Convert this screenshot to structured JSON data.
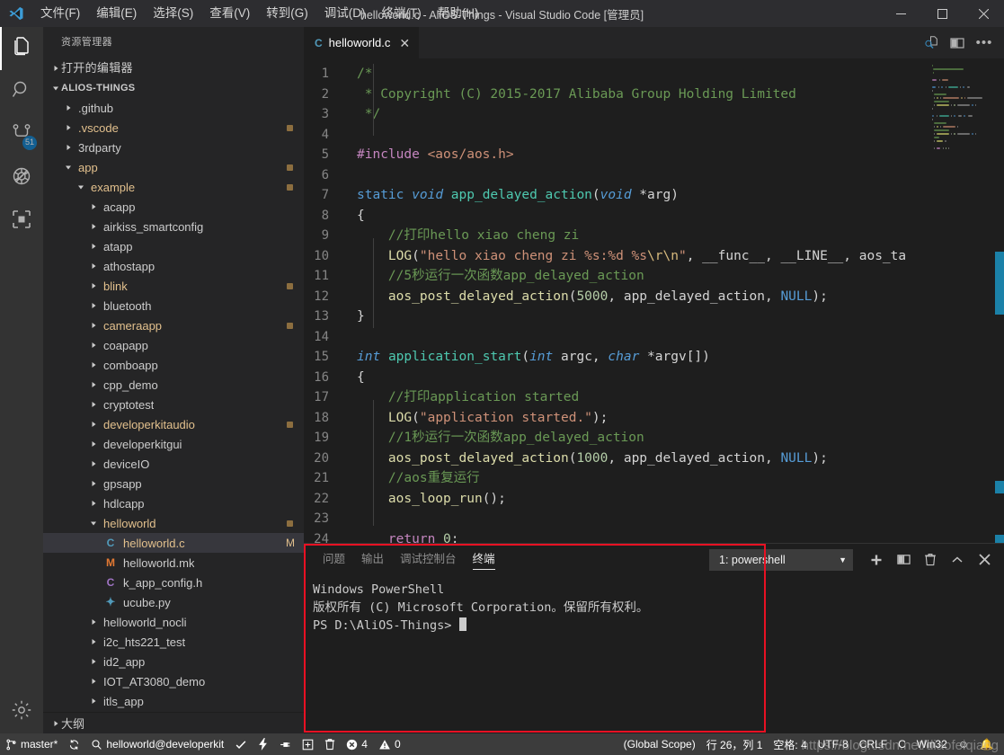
{
  "window": {
    "title": "helloworld.c - AliOS-Things - Visual Studio Code [管理员]",
    "minimize": "−",
    "maximize": "□",
    "close": "✕"
  },
  "menu": [
    {
      "label": "文件(F)"
    },
    {
      "label": "编辑(E)"
    },
    {
      "label": "选择(S)"
    },
    {
      "label": "查看(V)"
    },
    {
      "label": "转到(G)"
    },
    {
      "label": "调试(D)"
    },
    {
      "label": "终端(T)"
    },
    {
      "label": "帮助(H)"
    }
  ],
  "activitybar": {
    "items": [
      {
        "name": "explorer",
        "icon": "files-icon"
      },
      {
        "name": "search",
        "icon": "search-icon"
      },
      {
        "name": "source-control",
        "icon": "source-control-icon",
        "badge": "51"
      },
      {
        "name": "debug",
        "icon": "debug-icon"
      },
      {
        "name": "extensions",
        "icon": "extensions-icon"
      }
    ],
    "settings": {
      "name": "manage",
      "icon": "gear-icon"
    }
  },
  "sidebar": {
    "title": "资源管理器",
    "open_editors": "打开的编辑器",
    "project": "ALIOS-THINGS",
    "outline": "大纲",
    "tree": [
      {
        "label": ".github",
        "indent": 1,
        "type": "folder",
        "open": false,
        "modified": false,
        "dot": false
      },
      {
        "label": ".vscode",
        "indent": 1,
        "type": "folder",
        "open": false,
        "modified": true,
        "dot": true
      },
      {
        "label": "3rdparty",
        "indent": 1,
        "type": "folder",
        "open": false,
        "modified": false,
        "dot": false
      },
      {
        "label": "app",
        "indent": 1,
        "type": "folder",
        "open": true,
        "modified": true,
        "dot": true
      },
      {
        "label": "example",
        "indent": 2,
        "type": "folder",
        "open": true,
        "modified": true,
        "dot": true
      },
      {
        "label": "acapp",
        "indent": 3,
        "type": "folder",
        "open": false,
        "modified": false,
        "dot": false
      },
      {
        "label": "airkiss_smartconfig",
        "indent": 3,
        "type": "folder",
        "open": false,
        "modified": false,
        "dot": false
      },
      {
        "label": "atapp",
        "indent": 3,
        "type": "folder",
        "open": false,
        "modified": false,
        "dot": false
      },
      {
        "label": "athostapp",
        "indent": 3,
        "type": "folder",
        "open": false,
        "modified": false,
        "dot": false
      },
      {
        "label": "blink",
        "indent": 3,
        "type": "folder",
        "open": false,
        "modified": true,
        "dot": true
      },
      {
        "label": "bluetooth",
        "indent": 3,
        "type": "folder",
        "open": false,
        "modified": false,
        "dot": false
      },
      {
        "label": "cameraapp",
        "indent": 3,
        "type": "folder",
        "open": false,
        "modified": true,
        "dot": true
      },
      {
        "label": "coapapp",
        "indent": 3,
        "type": "folder",
        "open": false,
        "modified": false,
        "dot": false
      },
      {
        "label": "comboapp",
        "indent": 3,
        "type": "folder",
        "open": false,
        "modified": false,
        "dot": false
      },
      {
        "label": "cpp_demo",
        "indent": 3,
        "type": "folder",
        "open": false,
        "modified": false,
        "dot": false
      },
      {
        "label": "cryptotest",
        "indent": 3,
        "type": "folder",
        "open": false,
        "modified": false,
        "dot": false
      },
      {
        "label": "developerkitaudio",
        "indent": 3,
        "type": "folder",
        "open": false,
        "modified": true,
        "dot": true
      },
      {
        "label": "developerkitgui",
        "indent": 3,
        "type": "folder",
        "open": false,
        "modified": false,
        "dot": false
      },
      {
        "label": "deviceIO",
        "indent": 3,
        "type": "folder",
        "open": false,
        "modified": false,
        "dot": false
      },
      {
        "label": "gpsapp",
        "indent": 3,
        "type": "folder",
        "open": false,
        "modified": false,
        "dot": false
      },
      {
        "label": "hdlcapp",
        "indent": 3,
        "type": "folder",
        "open": false,
        "modified": false,
        "dot": false
      },
      {
        "label": "helloworld",
        "indent": 3,
        "type": "folder",
        "open": true,
        "modified": true,
        "dot": true
      },
      {
        "label": "helloworld.c",
        "indent": 4,
        "type": "file",
        "ext": "c",
        "selected": true,
        "modified": true,
        "badge": "M"
      },
      {
        "label": "helloworld.mk",
        "indent": 4,
        "type": "file",
        "ext": "mk"
      },
      {
        "label": "k_app_config.h",
        "indent": 4,
        "type": "file",
        "ext": "h"
      },
      {
        "label": "ucube.py",
        "indent": 4,
        "type": "file",
        "ext": "py"
      },
      {
        "label": "helloworld_nocli",
        "indent": 3,
        "type": "folder",
        "open": false,
        "modified": false,
        "dot": false
      },
      {
        "label": "i2c_hts221_test",
        "indent": 3,
        "type": "folder",
        "open": false,
        "modified": false,
        "dot": false
      },
      {
        "label": "id2_app",
        "indent": 3,
        "type": "folder",
        "open": false,
        "modified": false,
        "dot": false
      },
      {
        "label": "IOT_AT3080_demo",
        "indent": 3,
        "type": "folder",
        "open": false,
        "modified": false,
        "dot": false
      },
      {
        "label": "itls_app",
        "indent": 3,
        "type": "folder",
        "open": false,
        "modified": false,
        "dot": false
      }
    ]
  },
  "editor": {
    "tab": {
      "label": "helloworld.c",
      "icon": "c-file-icon",
      "close": "✕"
    },
    "actions": [
      {
        "name": "open-preview-icon"
      },
      {
        "name": "split-editor-icon"
      },
      {
        "name": "more-actions-icon",
        "label": "•••"
      }
    ],
    "lines": [
      {
        "n": 1,
        "gutter": "",
        "tokens": [
          {
            "t": "/*",
            "c": "cm"
          }
        ]
      },
      {
        "n": 2,
        "gutter": "",
        "tokens": [
          {
            "t": " * Copyright (C) 2015-2017 Alibaba Group Holding Limited",
            "c": "cm"
          }
        ]
      },
      {
        "n": 3,
        "gutter": "",
        "tokens": [
          {
            "t": " */",
            "c": "cm"
          }
        ]
      },
      {
        "n": 4,
        "gutter": "",
        "tokens": []
      },
      {
        "n": 5,
        "gutter": "",
        "tokens": [
          {
            "t": "#include",
            "c": "pp"
          },
          {
            "t": " ",
            "c": "op"
          },
          {
            "t": "<aos/aos.h>",
            "c": "st"
          }
        ]
      },
      {
        "n": 6,
        "gutter": "",
        "tokens": []
      },
      {
        "n": 7,
        "gutter": "",
        "tokens": [
          {
            "t": "static",
            "c": "k"
          },
          {
            "t": " ",
            "c": "op"
          },
          {
            "t": "void",
            "c": "ki"
          },
          {
            "t": " ",
            "c": "op"
          },
          {
            "t": "app_delayed_action",
            "c": "fnc"
          },
          {
            "t": "(",
            "c": "op"
          },
          {
            "t": "void",
            "c": "ki"
          },
          {
            "t": " *arg)",
            "c": "op"
          }
        ]
      },
      {
        "n": 8,
        "gutter": "",
        "tokens": [
          {
            "t": "{",
            "c": "op"
          }
        ]
      },
      {
        "n": 9,
        "gutter": "mod",
        "tokens": [
          {
            "t": "    //打印hello xiao cheng zi",
            "c": "cm"
          }
        ]
      },
      {
        "n": 10,
        "gutter": "mod",
        "tokens": [
          {
            "t": "    ",
            "c": "op"
          },
          {
            "t": "LOG",
            "c": "fn"
          },
          {
            "t": "(",
            "c": "op"
          },
          {
            "t": "\"hello xiao cheng zi %s:%d %s",
            "c": "st"
          },
          {
            "t": "\\r\\n",
            "c": "esc"
          },
          {
            "t": "\"",
            "c": "st"
          },
          {
            "t": ", __func__, __LINE__, aos_ta",
            "c": "op"
          }
        ]
      },
      {
        "n": 11,
        "gutter": "mod",
        "tokens": [
          {
            "t": "    //5秒运行一次函数app_delayed_action",
            "c": "cm"
          }
        ]
      },
      {
        "n": 12,
        "gutter": "",
        "tokens": [
          {
            "t": "    ",
            "c": "op"
          },
          {
            "t": "aos_post_delayed_action",
            "c": "fn"
          },
          {
            "t": "(",
            "c": "op"
          },
          {
            "t": "5000",
            "c": "num"
          },
          {
            "t": ", app_delayed_action, ",
            "c": "op"
          },
          {
            "t": "NULL",
            "c": "k"
          },
          {
            "t": ");",
            "c": "op"
          }
        ]
      },
      {
        "n": 13,
        "gutter": "",
        "tokens": [
          {
            "t": "}",
            "c": "op"
          }
        ]
      },
      {
        "n": 14,
        "gutter": "",
        "tokens": []
      },
      {
        "n": 15,
        "gutter": "",
        "tokens": [
          {
            "t": "int",
            "c": "ki"
          },
          {
            "t": " ",
            "c": "op"
          },
          {
            "t": "application_start",
            "c": "fnc"
          },
          {
            "t": "(",
            "c": "op"
          },
          {
            "t": "int",
            "c": "ki"
          },
          {
            "t": " argc, ",
            "c": "op"
          },
          {
            "t": "char",
            "c": "ki"
          },
          {
            "t": " *argv[])",
            "c": "op"
          }
        ]
      },
      {
        "n": 16,
        "gutter": "",
        "tokens": [
          {
            "t": "{",
            "c": "op"
          }
        ]
      },
      {
        "n": 17,
        "gutter": "add",
        "tokens": [
          {
            "t": "    //打印application started",
            "c": "cm"
          }
        ]
      },
      {
        "n": 18,
        "gutter": "",
        "tokens": [
          {
            "t": "    ",
            "c": "op"
          },
          {
            "t": "LOG",
            "c": "fn"
          },
          {
            "t": "(",
            "c": "op"
          },
          {
            "t": "\"application started.\"",
            "c": "st"
          },
          {
            "t": ");",
            "c": "op"
          }
        ]
      },
      {
        "n": 19,
        "gutter": "add",
        "tokens": [
          {
            "t": "    //1秒运行一次函数app_delayed_action",
            "c": "cm"
          }
        ]
      },
      {
        "n": 20,
        "gutter": "",
        "tokens": [
          {
            "t": "    ",
            "c": "op"
          },
          {
            "t": "aos_post_delayed_action",
            "c": "fn"
          },
          {
            "t": "(",
            "c": "op"
          },
          {
            "t": "1000",
            "c": "num"
          },
          {
            "t": ", app_delayed_action, ",
            "c": "op"
          },
          {
            "t": "NULL",
            "c": "k"
          },
          {
            "t": ");",
            "c": "op"
          }
        ]
      },
      {
        "n": 21,
        "gutter": "add",
        "tokens": [
          {
            "t": "    //aos重复运行",
            "c": "cm"
          }
        ]
      },
      {
        "n": 22,
        "gutter": "",
        "tokens": [
          {
            "t": "    ",
            "c": "op"
          },
          {
            "t": "aos_loop_run",
            "c": "fn"
          },
          {
            "t": "();",
            "c": "op"
          }
        ]
      },
      {
        "n": 23,
        "gutter": "",
        "tokens": []
      },
      {
        "n": 24,
        "gutter": "",
        "tokens": [
          {
            "t": "    ",
            "c": "op"
          },
          {
            "t": "return",
            "c": "pp"
          },
          {
            "t": " ",
            "c": "op"
          },
          {
            "t": "0",
            "c": "num"
          },
          {
            "t": ";",
            "c": "op"
          }
        ]
      }
    ]
  },
  "panel": {
    "tabs": [
      {
        "label": "问题",
        "active": false
      },
      {
        "label": "输出",
        "active": false
      },
      {
        "label": "调试控制台",
        "active": false
      },
      {
        "label": "终端",
        "active": true
      }
    ],
    "terminal_select": {
      "value": "1: powershell",
      "caret": "▼"
    },
    "actions": [
      {
        "name": "new-terminal-icon"
      },
      {
        "name": "split-terminal-icon"
      },
      {
        "name": "kill-terminal-icon"
      },
      {
        "name": "collapse-panel-icon"
      },
      {
        "name": "close-panel-icon"
      }
    ],
    "terminal_lines": [
      "Windows PowerShell",
      "版权所有 (C) Microsoft Corporation。保留所有权利。",
      "",
      "PS D:\\AliOS-Things> "
    ]
  },
  "statusbar": {
    "left": [
      {
        "name": "branch",
        "icon": "source-control-branch-icon",
        "label": "master*"
      },
      {
        "name": "sync",
        "icon": "sync-icon",
        "label": ""
      },
      {
        "name": "target",
        "icon": "search-icon",
        "label": "helloworld@developerkit"
      },
      {
        "name": "build",
        "icon": "check-icon",
        "label": ""
      },
      {
        "name": "flash",
        "icon": "lightning-icon",
        "label": ""
      },
      {
        "name": "plug",
        "icon": "plug-icon",
        "label": ""
      },
      {
        "name": "add",
        "icon": "add-box-icon",
        "label": ""
      },
      {
        "name": "clean",
        "icon": "trash-icon",
        "label": ""
      },
      {
        "name": "errors",
        "icon": "error-icon",
        "label": "4"
      },
      {
        "name": "warnings",
        "icon": "warning-icon",
        "label": "0"
      }
    ],
    "right": [
      {
        "name": "scope",
        "label": "(Global Scope)"
      },
      {
        "name": "cursor-position",
        "label": "行 26，列 1"
      },
      {
        "name": "indentation",
        "label": "空格: 4"
      },
      {
        "name": "encoding",
        "label": "UTF-8"
      },
      {
        "name": "eol",
        "label": "CRLF"
      },
      {
        "name": "language-mode",
        "label": "C"
      },
      {
        "name": "platform",
        "label": "Win32"
      },
      {
        "name": "feedback",
        "label": "☺"
      },
      {
        "name": "notifications",
        "label": "🔔"
      }
    ]
  },
  "watermark": "https://blog.csdn.net/diaofeiqiang",
  "colors": {
    "accent": "#007acc",
    "annotation": "#e81123",
    "modified": "#e2c08d",
    "added_gutter": "#587c0c",
    "modified_gutter": "#0c7d9d"
  }
}
